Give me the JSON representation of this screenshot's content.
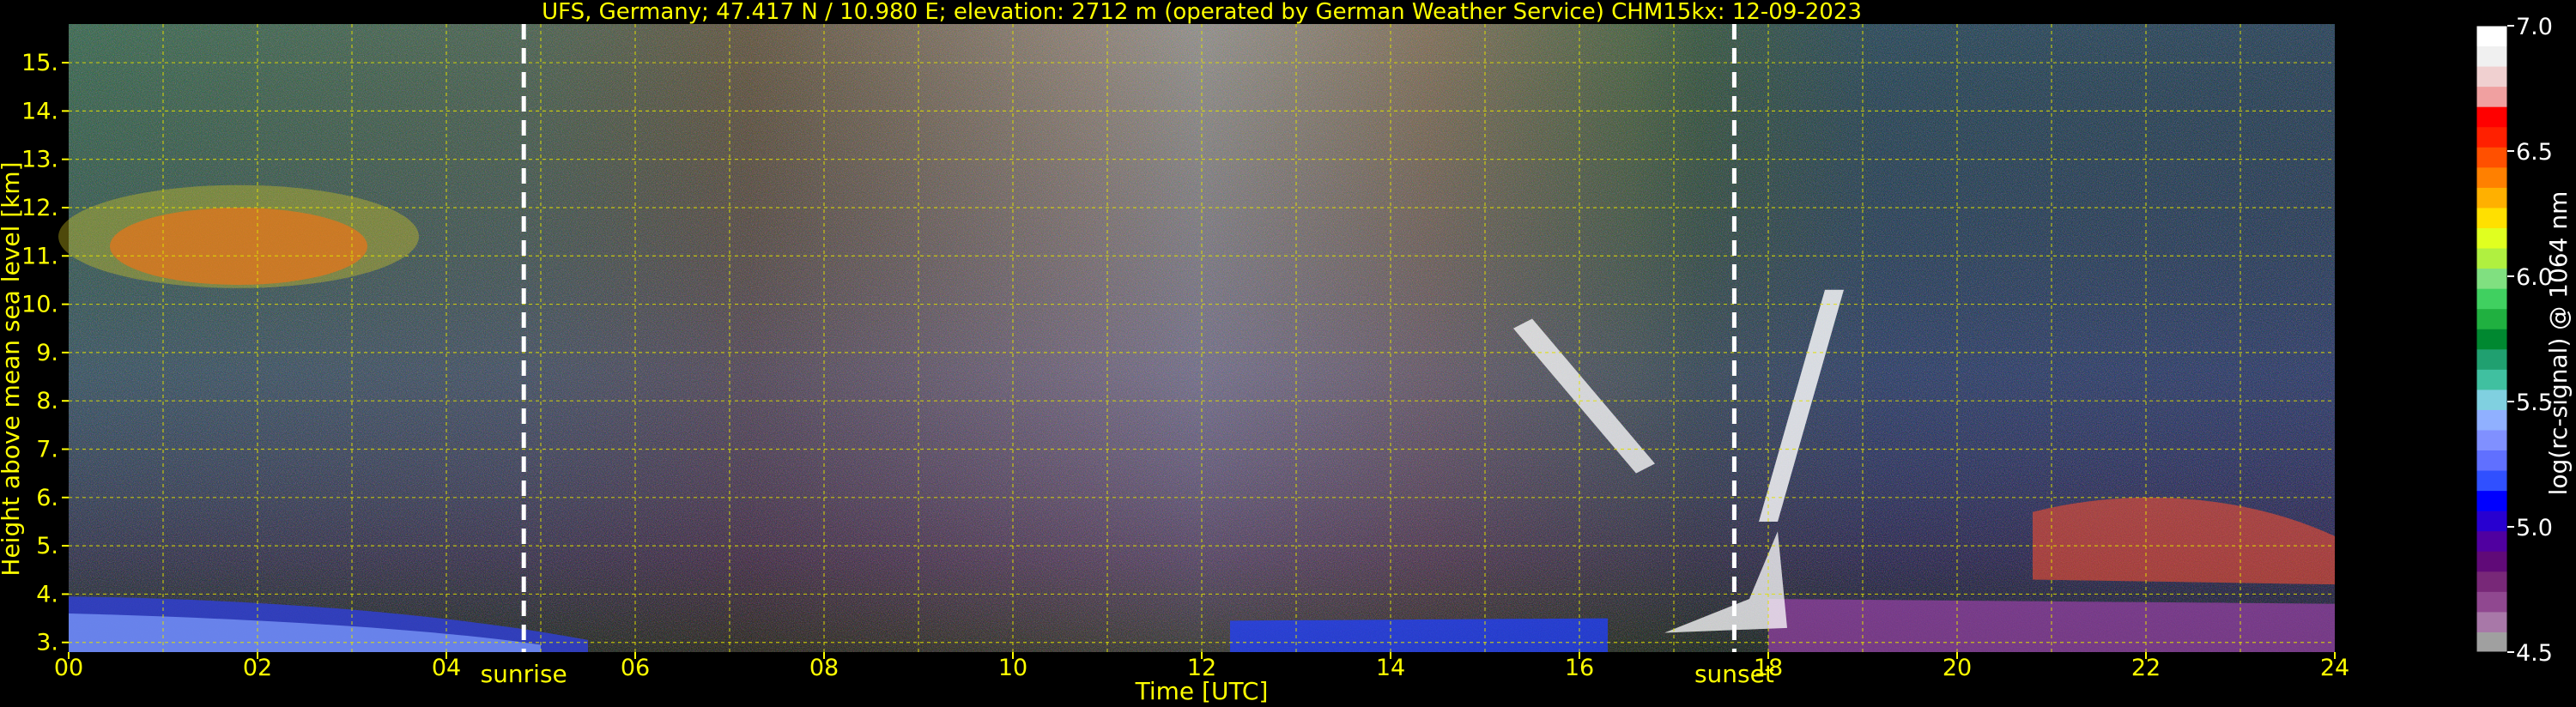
{
  "chart_data": {
    "type": "heatmap",
    "title": "UFS, Germany; 47.417 N / 10.980 E; elevation: 2712 m  (operated by German Weather Service)    CHM15kx: 12-09-2023",
    "xlabel": "Time [UTC]",
    "ylabel": "Height above mean sea level [km]",
    "xlim": [
      0,
      24
    ],
    "ylim": [
      2.8,
      15.8
    ],
    "x_ticks": [
      "00",
      "02",
      "04",
      "06",
      "08",
      "10",
      "12",
      "14",
      "16",
      "18",
      "20",
      "22",
      "24"
    ],
    "y_ticks": [
      "3.",
      "4.",
      "5.",
      "6.",
      "7.",
      "8.",
      "9.",
      "10.",
      "11.",
      "12.",
      "13.",
      "14.",
      "15."
    ],
    "grid": true,
    "markers": [
      {
        "label": "sunrise",
        "x": 4.82
      },
      {
        "label": "sunset",
        "x": 17.64
      }
    ],
    "colorbar": {
      "label": "log(rc-signal) @ 1064 nm",
      "range": [
        4.5,
        7.0
      ],
      "ticks": [
        "4.5",
        "5.0",
        "5.5",
        "6.0",
        "6.5",
        "7.0"
      ],
      "colors": [
        "#a0a0a0",
        "#a878a8",
        "#904890",
        "#782878",
        "#600a78",
        "#5000a0",
        "#2800d0",
        "#0000ff",
        "#3050ff",
        "#6070ff",
        "#8090ff",
        "#90b0ff",
        "#80d0e0",
        "#40c0a0",
        "#20a070",
        "#008830",
        "#20b040",
        "#40d060",
        "#80e080",
        "#b0f040",
        "#e0ff20",
        "#ffe000",
        "#ffb000",
        "#ff8000",
        "#ff5000",
        "#ff2000",
        "#ff0000",
        "#f0a0a0",
        "#f0d0d0",
        "#f0f0f0",
        "#ffffff"
      ]
    }
  }
}
